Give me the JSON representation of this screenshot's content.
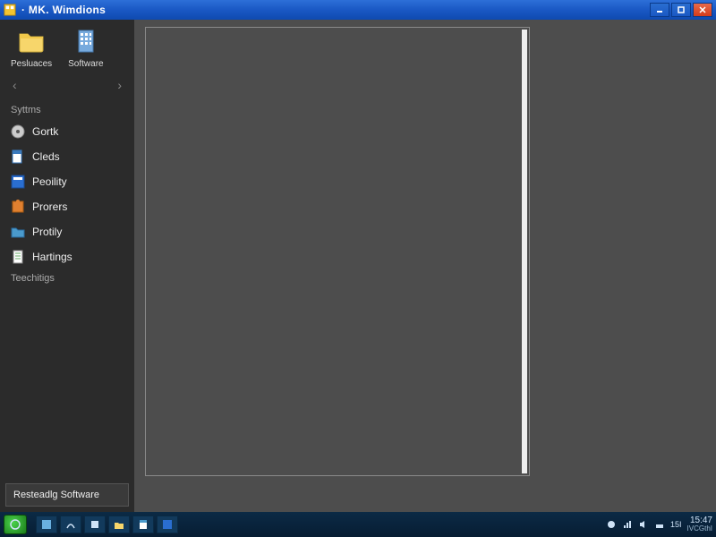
{
  "titlebar": {
    "title": "· MK. Wimdions"
  },
  "sidebar": {
    "top_icons": [
      {
        "label": "Pesluaces",
        "icon_name": "folder-icon"
      },
      {
        "label": "Software",
        "icon_name": "building-icon"
      }
    ],
    "section1_label": "Syttms",
    "items": [
      {
        "label": "Gortk",
        "icon_name": "cd-icon"
      },
      {
        "label": "Cleds",
        "icon_name": "doc-blue-icon"
      },
      {
        "label": "Peoility",
        "icon_name": "app-icon"
      },
      {
        "label": "Prorers",
        "icon_name": "puzzle-icon"
      },
      {
        "label": "Protily",
        "icon_name": "folder-blue-icon"
      },
      {
        "label": "Hartings",
        "icon_name": "page-icon"
      }
    ],
    "section2_label": "Teechitigs",
    "bottom_button": "Resteadlg Software"
  },
  "taskbar": {
    "clock_time": "15:47",
    "clock_date": "IVCGthI"
  }
}
